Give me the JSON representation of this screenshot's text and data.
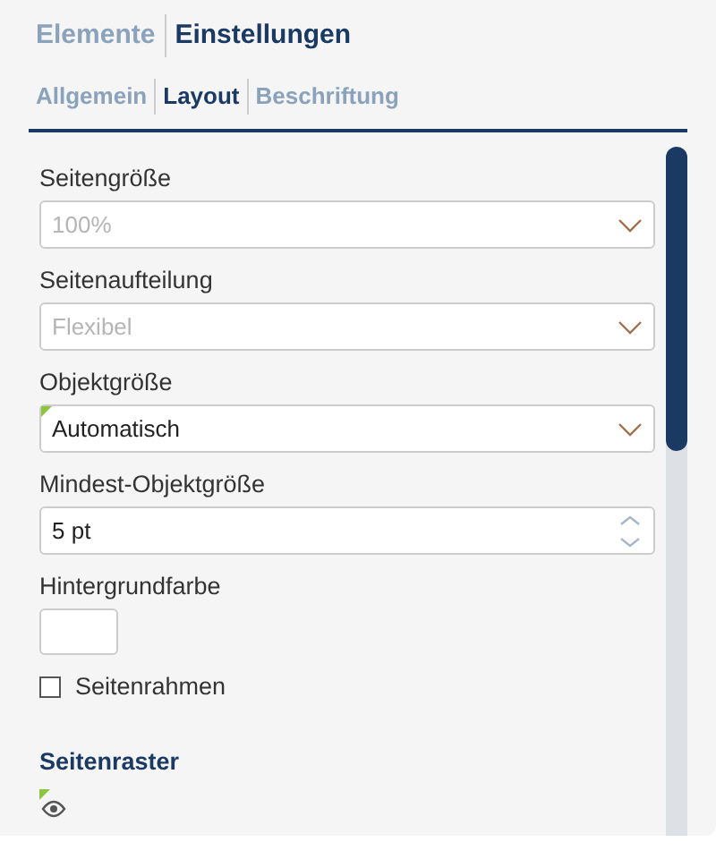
{
  "tabs": [
    {
      "label": "Elemente",
      "selected": false
    },
    {
      "label": "Einstellungen",
      "selected": true
    }
  ],
  "subtabs": [
    {
      "label": "Allgemein",
      "selected": false
    },
    {
      "label": "Layout",
      "selected": true
    },
    {
      "label": "Beschriftung",
      "selected": false
    }
  ],
  "fields": [
    {
      "kind": "select",
      "label": "Seitengröße",
      "placeholder": "100%",
      "modified": false
    },
    {
      "kind": "select",
      "label": "Seitenaufteilung",
      "placeholder": "Flexibel",
      "modified": false
    },
    {
      "kind": "select",
      "label": "Objektgröße",
      "value": "Automatisch",
      "modified": true
    },
    {
      "kind": "spinner",
      "label": "Mindest-Objektgröße",
      "value": "5 pt",
      "modified": false
    },
    {
      "kind": "color",
      "label": "Hintergrundfarbe",
      "color": "#ffffff"
    },
    {
      "kind": "checkbox",
      "label": "Seitenrahmen",
      "checked": false
    },
    {
      "kind": "heading",
      "label": "Seitenraster"
    },
    {
      "kind": "visibility",
      "modified": true
    }
  ]
}
